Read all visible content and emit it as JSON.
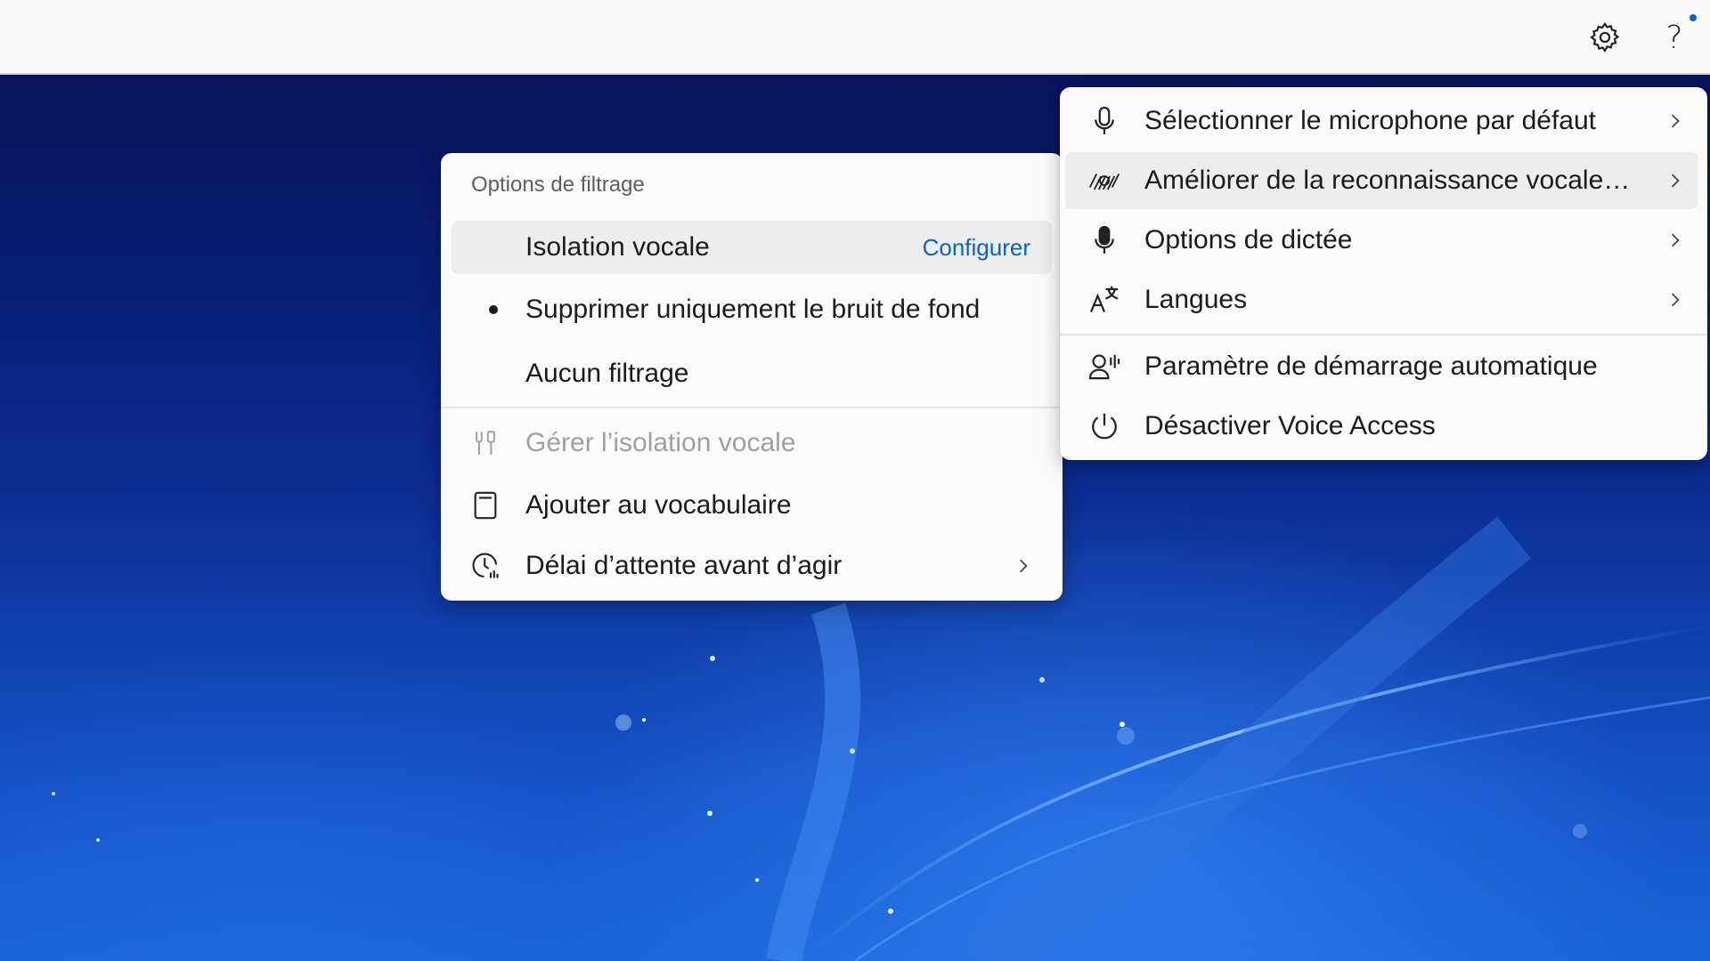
{
  "topbar": {
    "settings_icon": "gear-icon",
    "help_icon": "question-icon",
    "help_glyph": "?",
    "notification_color": "#0a64c8"
  },
  "filter_menu": {
    "header": "Options de filtrage",
    "items": [
      {
        "label": "Isolation vocale",
        "action": "Configurer",
        "state": "hover"
      },
      {
        "label": "Supprimer uniquement le bruit de fond",
        "selected": true
      },
      {
        "label": "Aucun filtrage"
      }
    ],
    "tools": [
      {
        "label": "Gérer l’isolation vocale",
        "icon": "tools-icon",
        "disabled": true
      },
      {
        "label": "Ajouter au vocabulaire",
        "icon": "book-icon"
      },
      {
        "label": "Délai d’attente avant d’agir",
        "icon": "clock-icon",
        "submenu": true
      }
    ]
  },
  "settings_menu": {
    "items": [
      {
        "label": "Sélectionner le microphone par défaut",
        "icon": "microphone-icon",
        "submenu": true
      },
      {
        "label": "Améliorer de la reconnaissance vocale…",
        "icon": "voice-training-icon",
        "submenu": true,
        "state": "hover"
      },
      {
        "label": "Options de dictée",
        "icon": "dictation-mic-icon",
        "submenu": true
      },
      {
        "label": "Langues",
        "icon": "language-icon",
        "submenu": true
      },
      {
        "label": "Paramètre de démarrage automatique",
        "icon": "person-voice-icon"
      },
      {
        "label": "Désactiver Voice Access",
        "icon": "power-icon"
      }
    ]
  },
  "colors": {
    "accent": "#0a64c8",
    "menu_bg": "#fbfbfb",
    "hover_bg": "#ededed",
    "disabled_text": "#9f9f9f"
  }
}
